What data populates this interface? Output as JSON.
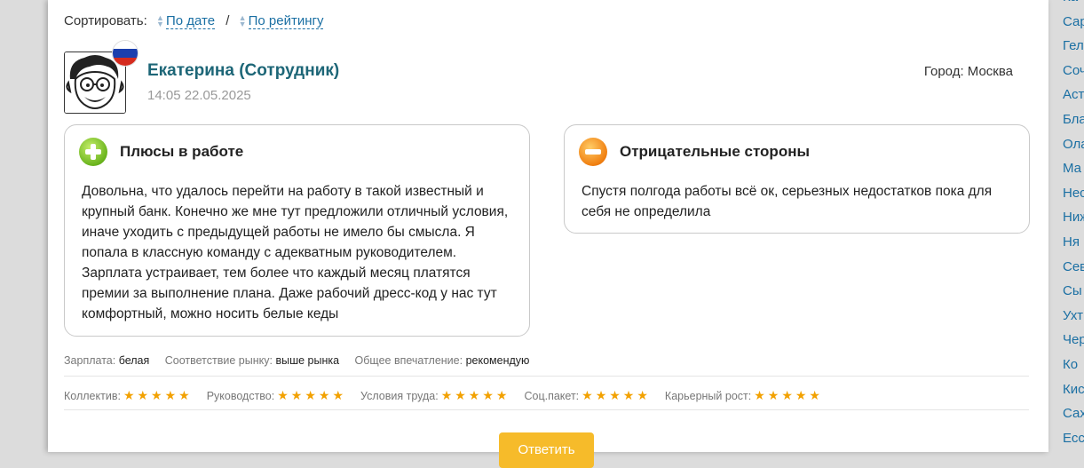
{
  "sort": {
    "label": "Сортировать:",
    "by_date": "По дате",
    "separator": "/",
    "by_rating": "По рейтингу"
  },
  "review": {
    "author": "Екатерина (Сотрудник)",
    "datetime": "14:05 22.05.2025",
    "city": "Город: Москва",
    "pros": {
      "title": "Плюсы в работе",
      "text": "Довольна, что удалось перейти на работу в такой известный и крупный банк. Конечно же мне тут предложили отличный условия, иначе уходить с предыдущей работы не имело бы смысла. Я попала в классную команду с адекватным руководителем. Зарплата устраивает, тем более что каждый месяц платятся премии за выполнение плана. Даже рабочий дресс-код у нас тут комфортный, можно носить белые кеды"
    },
    "cons": {
      "title": "Отрицательные стороны",
      "text": "Спустя полгода работы всё ок, серьезных недостатков пока для себя не определила"
    },
    "meta": {
      "salary_label": "Зарплата:",
      "salary_value": "белая",
      "market_label": "Соответствие рынку:",
      "market_value": "выше рынка",
      "impression_label": "Общее впечатление:",
      "impression_value": "рекомендую"
    },
    "ratings": [
      {
        "label": "Коллектив:",
        "stars": 5
      },
      {
        "label": "Руководство:",
        "stars": 5
      },
      {
        "label": "Условия труда:",
        "stars": 5
      },
      {
        "label": "Соц.пакет:",
        "stars": 5
      },
      {
        "label": "Карьерный рост:",
        "stars": 5
      }
    ],
    "reply_label": "Ответить"
  },
  "cities_sidebar": [
    "Ка",
    "Сар",
    "Гел",
    "Соч",
    "Аст",
    "Бла",
    "Ола",
    "Ма",
    "Нес",
    "Ниж",
    "Ня",
    "Сев",
    "Сы",
    "Ухт",
    "Чер",
    "Ко",
    "Кис",
    "Сах",
    "Есс"
  ],
  "colors": {
    "link": "#1a6fa3",
    "author": "#1d6677",
    "star": "#f2a100",
    "reply_button": "#f6bb2a",
    "pros_icon": "#6ab41d",
    "cons_icon": "#f07f10"
  }
}
